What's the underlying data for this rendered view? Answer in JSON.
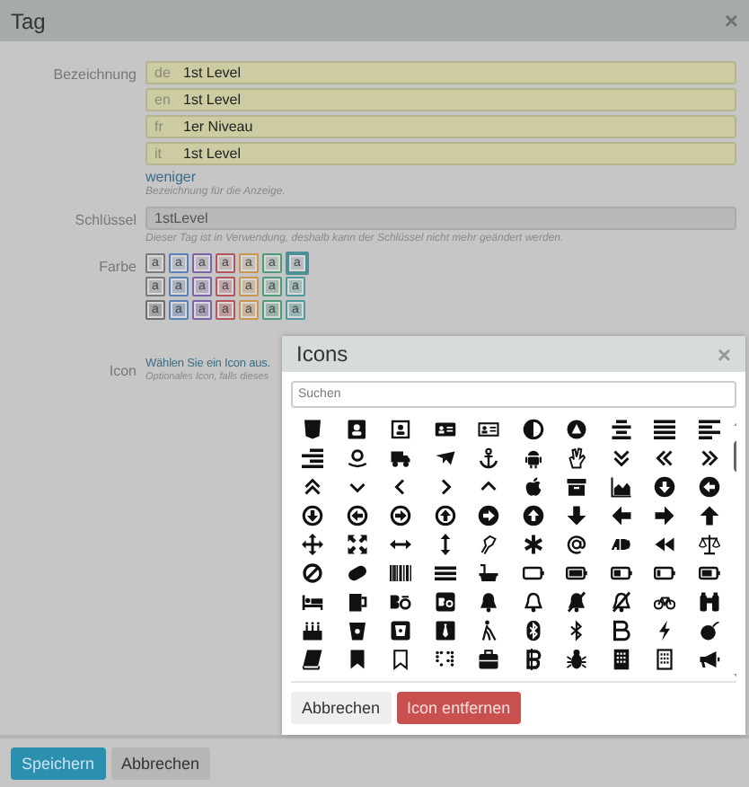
{
  "window": {
    "title": "Tag",
    "close": "×"
  },
  "name_field": {
    "label": "Bezeichnung",
    "translations": [
      {
        "lang": "de",
        "value": "1st Level"
      },
      {
        "lang": "en",
        "value": "1st Level"
      },
      {
        "lang": "fr",
        "value": "1er Niveau"
      },
      {
        "lang": "it",
        "value": "1st Level"
      }
    ],
    "toggle_link": "weniger",
    "hint": "Bezeichnung für die Anzeige."
  },
  "key_field": {
    "label": "Schlüssel",
    "value": "1stLevel",
    "disabled": true,
    "hint": "Dieser Tag ist in Verwendung, deshalb kann der Schlüssel nicht mehr geändert werden."
  },
  "color_field": {
    "label": "Farbe",
    "rows": [
      [
        {
          "label": "a",
          "color": "#7a7a7a",
          "selected": false
        },
        {
          "label": "a",
          "color": "#5b7fb8",
          "selected": false
        },
        {
          "label": "a",
          "color": "#7a63a6",
          "selected": false
        },
        {
          "label": "a",
          "color": "#b5545c",
          "selected": false
        },
        {
          "label": "a",
          "color": "#c9964f",
          "selected": false
        },
        {
          "label": "a",
          "color": "#4f9a7a",
          "selected": false
        },
        {
          "label": "a",
          "color": "#4d8f94",
          "selected": true
        }
      ],
      [
        {
          "label": "a",
          "color": "#7a7a7a",
          "selected": false
        },
        {
          "label": "a",
          "color": "#5b7fb8",
          "selected": false
        },
        {
          "label": "a",
          "color": "#7a63a6",
          "selected": false
        },
        {
          "label": "a",
          "color": "#b5545c",
          "selected": false
        },
        {
          "label": "a",
          "color": "#c9964f",
          "selected": false
        },
        {
          "label": "a",
          "color": "#4f9a7a",
          "selected": false
        },
        {
          "label": "a",
          "color": "#4d9a9a",
          "selected": false
        }
      ],
      [
        {
          "label": "a",
          "color": "#6e6e6e",
          "selected": false
        },
        {
          "label": "a",
          "color": "#5b7fb8",
          "selected": false
        },
        {
          "label": "a",
          "color": "#7a63a6",
          "selected": false
        },
        {
          "label": "a",
          "color": "#b5545c",
          "selected": false
        },
        {
          "label": "a",
          "color": "#c9964f",
          "selected": false
        },
        {
          "label": "a",
          "color": "#4f9a7a",
          "selected": false
        },
        {
          "label": "a",
          "color": "#4d9a9a",
          "selected": false
        }
      ]
    ]
  },
  "icon_field": {
    "label": "Icon",
    "link": "Wählen Sie ein Icon aus.",
    "hint": "Optionales Icon, falls dieses"
  },
  "icon_dialog": {
    "title": "Icons",
    "close": "×",
    "search": {
      "placeholder": "Suchen"
    },
    "buttons": [
      {
        "label": "Abbrechen",
        "kind": "default"
      },
      {
        "label": "Icon entfernen",
        "kind": "danger"
      }
    ]
  },
  "footer_buttons": [
    {
      "label": "Speichern",
      "kind": "primary"
    },
    {
      "label": "Abbrechen",
      "kind": "default"
    }
  ]
}
